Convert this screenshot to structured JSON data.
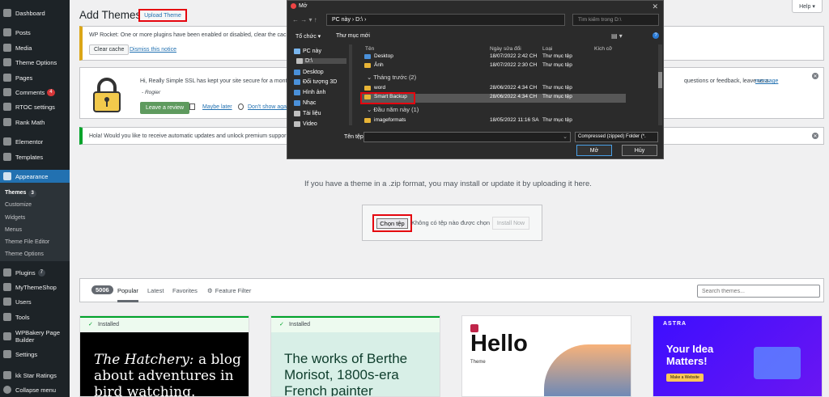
{
  "sidebar": {
    "items": [
      {
        "label": "Dashboard",
        "icon": "dashboard-icon"
      },
      {
        "label": "Posts",
        "icon": "pin-icon"
      },
      {
        "label": "Media",
        "icon": "media-icon"
      },
      {
        "label": "Theme Options",
        "icon": "options-icon"
      },
      {
        "label": "Pages",
        "icon": "pages-icon"
      },
      {
        "label": "Comments",
        "icon": "comments-icon",
        "badge": "4"
      },
      {
        "label": "RTOC settings",
        "icon": "list-icon"
      },
      {
        "label": "Rank Math",
        "icon": "chart-icon"
      },
      {
        "label": "Elementor",
        "icon": "elementor-icon"
      },
      {
        "label": "Templates",
        "icon": "folder-icon"
      },
      {
        "label": "Appearance",
        "icon": "brush-icon"
      },
      {
        "label": "Plugins",
        "icon": "plugin-icon",
        "badge": "7"
      },
      {
        "label": "MyThemeShop",
        "icon": "gear-icon"
      },
      {
        "label": "Users",
        "icon": "user-icon"
      },
      {
        "label": "Tools",
        "icon": "wrench-icon"
      },
      {
        "label": "WPBakery Page Builder",
        "icon": "builder-icon"
      },
      {
        "label": "Settings",
        "icon": "settings-icon"
      },
      {
        "label": "kk Star Ratings",
        "icon": "star-icon"
      },
      {
        "label": "Collapse menu",
        "icon": "collapse-icon"
      }
    ],
    "appearance_sub": [
      {
        "label": "Themes",
        "badge": "3"
      },
      {
        "label": "Customize"
      },
      {
        "label": "Widgets"
      },
      {
        "label": "Menus"
      },
      {
        "label": "Theme File Editor"
      },
      {
        "label": "Theme Options"
      }
    ]
  },
  "header": {
    "title": "Add Themes",
    "upload_label": "Upload Theme",
    "help_label": "Help ▾"
  },
  "notices": {
    "rocket": {
      "text": "WP Rocket: One or more plugins have been enabled or disabled, clear the cach",
      "clear_label": "Clear cache",
      "dismiss_label": "Dismiss this notice"
    },
    "ssl": {
      "text": "Hi, Really Simple SSL has kept your site secure for a month",
      "text_right": "questions or feedback, leave us a",
      "message_link": "message",
      "signature": "- Rogier",
      "review_label": "Leave a review",
      "later_label": "Maybe later",
      "dont_label": "Don't show aga"
    },
    "hola": {
      "text": "Hola! Would you like to receive automatic updates and unlock premium suppor"
    }
  },
  "upload": {
    "instructions": "If you have a theme in a .zip format, you may install or update it by uploading it here.",
    "choose_label": "Chọn tệp",
    "no_file_label": "Không có tệp nào được chọn",
    "install_label": "Install Now"
  },
  "filter": {
    "count": "5006",
    "tabs": [
      "Popular",
      "Latest",
      "Favorites"
    ],
    "feature_filter": "Feature Filter",
    "search_placeholder": "Search themes..."
  },
  "cards": [
    {
      "installed": "Installed",
      "headline_em": "The Hatchery:",
      "headline": " a blog about adventures in bird watching."
    },
    {
      "installed": "Installed",
      "headline": "The works of Berthe Morisot, 1800s-era French painter"
    },
    {
      "big": "Hello",
      "small": "Theme"
    },
    {
      "logo": "ASTRA",
      "headline": "Your Idea Matters!",
      "cta": "Make a Website"
    }
  ],
  "dialog": {
    "title": "Mở",
    "address": "PC này  ›  D:\\  ›",
    "search_placeholder": "Tìm kiếm trong D:\\",
    "organize": "Tổ chức ▾",
    "new_folder": "Thư mục mới",
    "nav": [
      {
        "label": "PC này",
        "color": "#7ab6ee"
      },
      {
        "label": "D:\\",
        "color": "#bfbfbf"
      },
      {
        "label": "Desktop",
        "color": "#4a90d9"
      },
      {
        "label": "Đối tượng 3D",
        "color": "#4a90d9"
      },
      {
        "label": "Hình ảnh",
        "color": "#4a90d9"
      },
      {
        "label": "Nhạc",
        "color": "#4a90d9"
      },
      {
        "label": "Tài liệu",
        "color": "#bfbfbf"
      },
      {
        "label": "Video",
        "color": "#bfbfbf"
      }
    ],
    "columns": {
      "name": "Tên",
      "date": "Ngày sửa đổi",
      "type": "Loại",
      "size": "Kích cỡ"
    },
    "rows_top": [
      {
        "name": "Desktop",
        "date": "18/07/2022 2:42 CH",
        "type": "Thư mục tệp"
      },
      {
        "name": "Ảnh",
        "date": "18/07/2022 2:30 CH",
        "type": "Thư mục tệp"
      }
    ],
    "group1": "Tháng trước (2)",
    "rows_mid": [
      {
        "name": "word",
        "date": "28/06/2022 4:34 CH",
        "type": "Thư mục tệp"
      },
      {
        "name": "Smart Backup",
        "date": "28/06/2022 4:34 CH",
        "type": "Thư mục tệp"
      }
    ],
    "group2": "Đầu năm này (1)",
    "rows_bot": [
      {
        "name": "imageformats",
        "date": "18/05/2022 11:16 SA",
        "type": "Thư mục tệp"
      }
    ],
    "filename_label": "Tên tệp:",
    "filter_value": "Compressed (zipped) Folder (*.",
    "open_label": "Mở",
    "cancel_label": "Hủy"
  },
  "colors": {
    "sidebar": "#1d2327",
    "accent": "#2271b1",
    "highlight": "#e5050e"
  }
}
